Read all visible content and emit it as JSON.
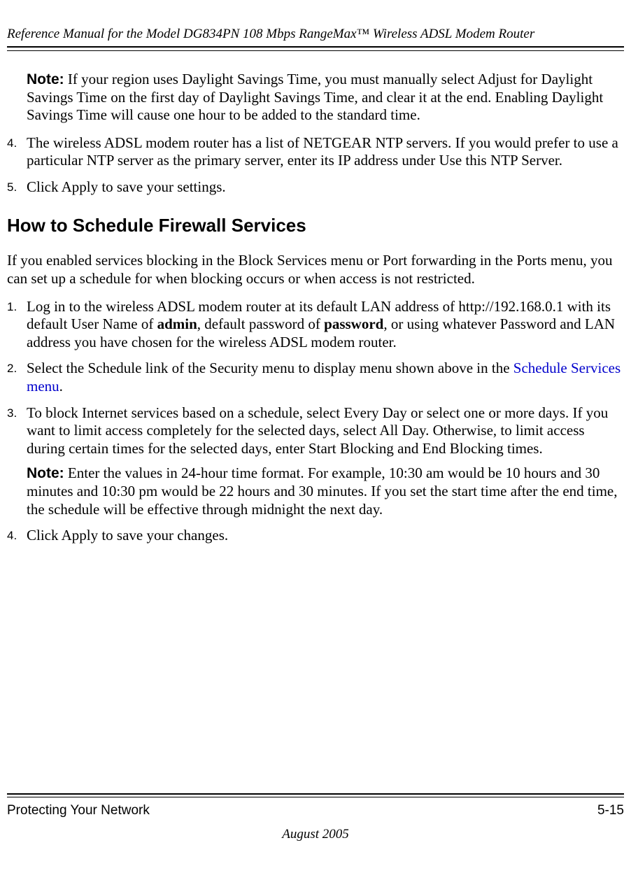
{
  "header": {
    "running_title": "Reference Manual for the Model DG834PN 108 Mbps RangeMax™ Wireless ADSL Modem Router"
  },
  "top_note": {
    "label": "Note:",
    "text": " If your region uses Daylight Savings Time, you must manually select Adjust for Daylight Savings Time on the first day of Daylight Savings Time, and clear it at the end. Enabling Daylight Savings Time will cause one hour to be added to the standard time."
  },
  "list_a": {
    "item4": {
      "num": "4.",
      "text": "The wireless ADSL modem router has a list of NETGEAR NTP servers. If you would prefer to use a particular NTP server as the primary server, enter its IP address under Use this NTP Server."
    },
    "item5": {
      "num": "5.",
      "text": "Click Apply to save your settings."
    }
  },
  "heading": "How to Schedule Firewall Services",
  "intro": "If you enabled services blocking in the Block Services menu or Port forwarding in the Ports menu, you can set up a schedule for when blocking occurs or when access is not restricted.",
  "list_b": {
    "item1": {
      "num": "1.",
      "pre": "Log in to the wireless ADSL modem router at its default LAN address of http://192.168.0.1 with its default User Name of ",
      "b1": "admin",
      "mid": ", default password of ",
      "b2": "password",
      "post": ", or using whatever Password and LAN address you have chosen for the wireless ADSL modem router."
    },
    "item2": {
      "num": "2.",
      "pre": "Select the Schedule link of the Security menu to display menu shown above in the ",
      "link": "Schedule Services menu",
      "post": "."
    },
    "item3": {
      "num": "3.",
      "text": "To block Internet services based on a schedule, select Every Day or select one or more days. If you want to limit access completely for the selected days, select All Day. Otherwise, to limit access during certain times for the selected days, enter Start Blocking and End Blocking times.",
      "note_label": "Note:",
      "note_text": " Enter the values in 24-hour time format. For example, 10:30 am would be 10 hours and 30 minutes and 10:30 pm would be 22 hours and 30 minutes. If you set the start time after the end time, the schedule will be effective through midnight the next day."
    },
    "item4": {
      "num": "4.",
      "text": "Click Apply to save your changes."
    }
  },
  "footer": {
    "section": "Protecting Your Network",
    "page": "5-15",
    "date": "August 2005"
  }
}
